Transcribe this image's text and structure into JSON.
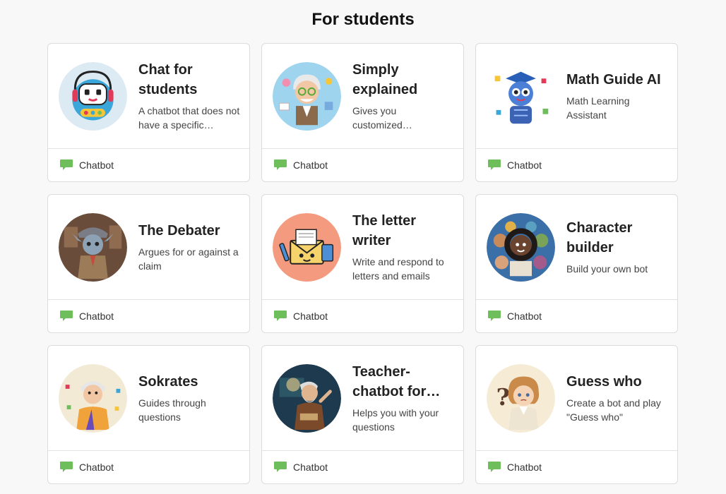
{
  "page": {
    "heading": "For students"
  },
  "colors": {
    "accent": "#6ebf5b"
  },
  "cards": [
    {
      "title": "Chat for students",
      "description": "A chatbot that does not have a specific…",
      "tag": "Chatbot",
      "tag_icon": "chat-bubble-icon",
      "avatar": "robot-headset-avatar"
    },
    {
      "title": "Simply explained",
      "description": "Gives you customized…",
      "tag": "Chatbot",
      "tag_icon": "chat-bubble-icon",
      "avatar": "professor-avatar"
    },
    {
      "title": "Math Guide AI",
      "description": "Math Learning Assistant",
      "tag": "Chatbot",
      "tag_icon": "chat-bubble-icon",
      "avatar": "math-robot-avatar"
    },
    {
      "title": "The Debater",
      "description": "Argues for or against a claim",
      "tag": "Chatbot",
      "tag_icon": "chat-bubble-icon",
      "avatar": "debater-avatar"
    },
    {
      "title": "The letter writer",
      "description": "Write and respond to letters and emails",
      "tag": "Chatbot",
      "tag_icon": "chat-bubble-icon",
      "avatar": "envelope-character-avatar"
    },
    {
      "title": "Character builder",
      "description": "Build your own bot",
      "tag": "Chatbot",
      "tag_icon": "chat-bubble-icon",
      "avatar": "characters-collage-avatar"
    },
    {
      "title": "Sokrates",
      "description": "Guides through questions",
      "tag": "Chatbot",
      "tag_icon": "chat-bubble-icon",
      "avatar": "sokrates-avatar"
    },
    {
      "title": "Teacher-chatbot for…",
      "description": "Helps you with your questions",
      "tag": "Chatbot",
      "tag_icon": "chat-bubble-icon",
      "avatar": "teacher-avatar"
    },
    {
      "title": "Guess who",
      "description": "Create a bot and play \"Guess who\"",
      "tag": "Chatbot",
      "tag_icon": "chat-bubble-icon",
      "avatar": "guess-who-avatar"
    }
  ]
}
